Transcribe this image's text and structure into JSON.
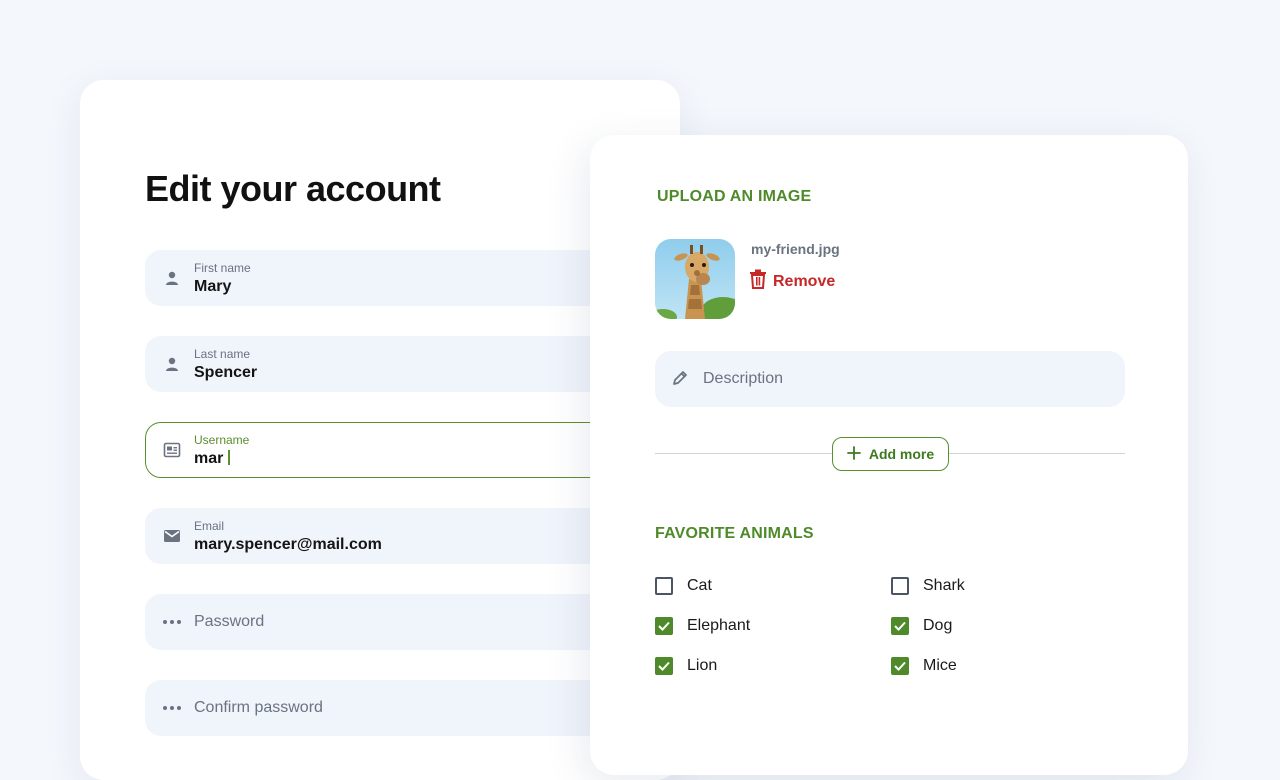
{
  "form": {
    "title": "Edit your account",
    "fields": [
      {
        "label": "First name",
        "value": "Mary",
        "icon": "person-icon"
      },
      {
        "label": "Last name",
        "value": "Spencer",
        "icon": "person-icon"
      },
      {
        "label": "Username",
        "value": "mar",
        "icon": "id-card-icon",
        "state": "focused"
      },
      {
        "label": "Email",
        "value": "mary.spencer@mail.com",
        "icon": "mail-icon"
      },
      {
        "placeholder": "Password",
        "icon": "dots-icon"
      },
      {
        "placeholder": "Confirm password",
        "icon": "dots-icon"
      }
    ]
  },
  "upload": {
    "title": "UPLOAD AN IMAGE",
    "filename": "my-friend.jpg",
    "remove_label": "Remove",
    "description_placeholder": "Description",
    "add_more_label": "Add more"
  },
  "animals": {
    "title": "FAVORITE ANIMALS",
    "items": [
      {
        "label": "Cat",
        "checked": false
      },
      {
        "label": "Shark",
        "checked": false
      },
      {
        "label": "Elephant",
        "checked": true
      },
      {
        "label": "Dog",
        "checked": true
      },
      {
        "label": "Lion",
        "checked": true
      },
      {
        "label": "Mice",
        "checked": true
      }
    ]
  },
  "colors": {
    "accent": "#4f8a2a",
    "danger": "#c62828",
    "field_bg": "#f0f4fb",
    "page_bg": "#f4f7fc"
  }
}
